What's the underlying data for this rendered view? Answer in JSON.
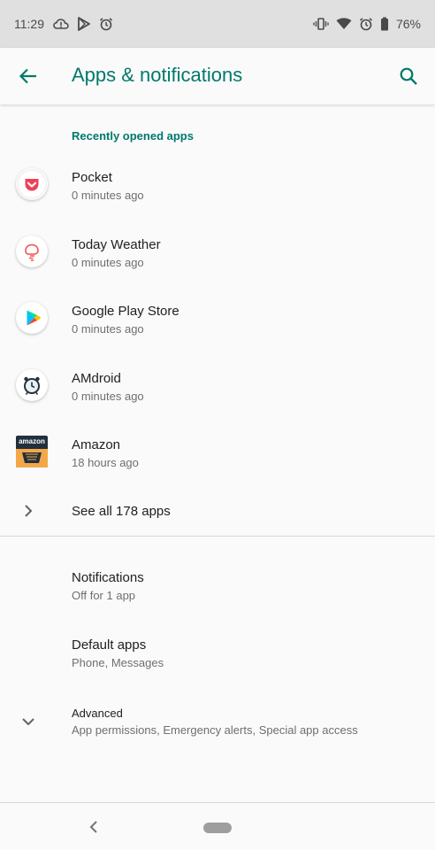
{
  "status_bar": {
    "time": "11:29",
    "battery": "76%",
    "icons_left": [
      "cloud-alert-icon",
      "play-store-icon",
      "alarm-icon"
    ],
    "icons_right": [
      "vibrate-icon",
      "wifi-icon",
      "alarm-icon",
      "battery-icon"
    ]
  },
  "app_bar": {
    "title": "Apps & notifications",
    "accent_color": "#00796b"
  },
  "recent": {
    "header": "Recently opened apps",
    "apps": [
      {
        "name": "Pocket",
        "time": "0 minutes ago",
        "icon": "pocket-icon"
      },
      {
        "name": "Today Weather",
        "time": "0 minutes ago",
        "icon": "today-weather-icon"
      },
      {
        "name": "Google Play Store",
        "time": "0 minutes ago",
        "icon": "play-store-icon"
      },
      {
        "name": "AMdroid",
        "time": "0 minutes ago",
        "icon": "alarm-clock-icon"
      },
      {
        "name": "Amazon",
        "time": "18 hours ago",
        "icon": "amazon-icon",
        "icon_text": "amazon"
      }
    ],
    "see_all": "See all 178 apps"
  },
  "settings": {
    "notifications": {
      "title": "Notifications",
      "subtitle": "Off for 1 app"
    },
    "default_apps": {
      "title": "Default apps",
      "subtitle": "Phone, Messages"
    },
    "advanced": {
      "title": "Advanced",
      "subtitle": "App permissions, Emergency alerts, Special app access"
    }
  }
}
